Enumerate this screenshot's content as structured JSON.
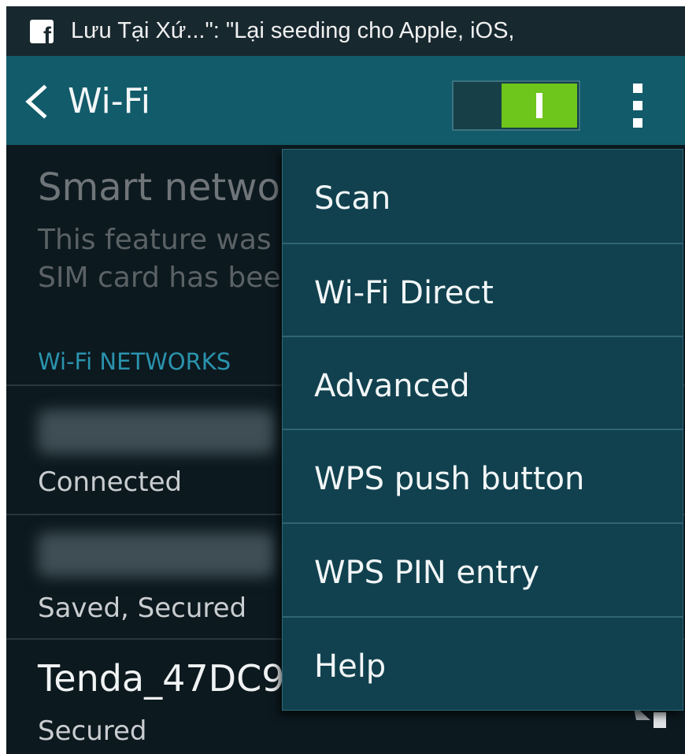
{
  "notification": {
    "app_icon": "facebook-icon",
    "text": "Lưu Tại Xứ...\": \"Lại seeding cho Apple, iOS,"
  },
  "actionbar": {
    "back_icon": "chevron-left-icon",
    "title": "Wi-Fi",
    "toggle_state": "on",
    "overflow_icon": "more-vert-icon"
  },
  "background": {
    "smart_network_title": "Smart netwo",
    "smart_network_desc_line1": "This feature was",
    "smart_network_desc_line2": "SIM card has bee",
    "section_header": "Wi-Fi NETWORKS",
    "networks": [
      {
        "name": "",
        "status": "Connected"
      },
      {
        "name": "",
        "status": "Saved, Secured"
      },
      {
        "name": "Tenda_47DC9",
        "status": "Secured"
      }
    ]
  },
  "menu": {
    "items": [
      {
        "label": "Scan"
      },
      {
        "label": "Wi-Fi Direct"
      },
      {
        "label": "Advanced"
      },
      {
        "label": "WPS push button"
      },
      {
        "label": "WPS PIN entry"
      },
      {
        "label": "Help"
      }
    ]
  },
  "colors": {
    "actionbar": "#125b6a",
    "statusbar": "#18282f",
    "menu_bg": "#11414e",
    "toggle_on": "#6ec51b",
    "section_header": "#2a93ad",
    "background": "#0c191f"
  }
}
